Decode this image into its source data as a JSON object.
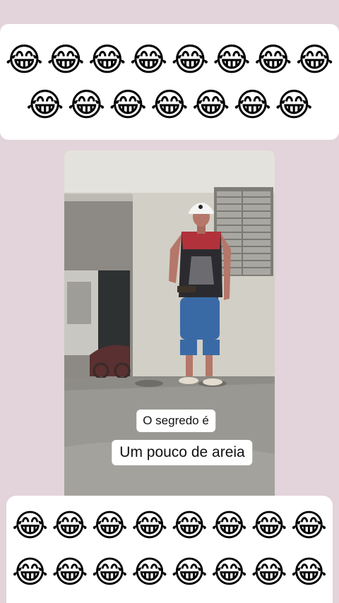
{
  "emoji_top": {
    "row1": [
      "😂",
      "😂",
      "😂",
      "😂",
      "😂",
      "😂",
      "😂",
      "😂"
    ],
    "row2": [
      "😂",
      "😂",
      "😂",
      "😂",
      "😂",
      "😂",
      "😂"
    ]
  },
  "emoji_bottom": {
    "row1": [
      "😂",
      "😂",
      "😂",
      "😂",
      "😂",
      "😂",
      "😂",
      "😂"
    ],
    "row2": [
      "😂",
      "😂",
      "😂",
      "😂",
      "😂",
      "😂",
      "😂",
      "😂"
    ]
  },
  "captions": {
    "line1": "O segredo é",
    "line2": "Um pouco de areia"
  },
  "colors": {
    "background": "#e3d3da",
    "card": "#ffffff"
  }
}
